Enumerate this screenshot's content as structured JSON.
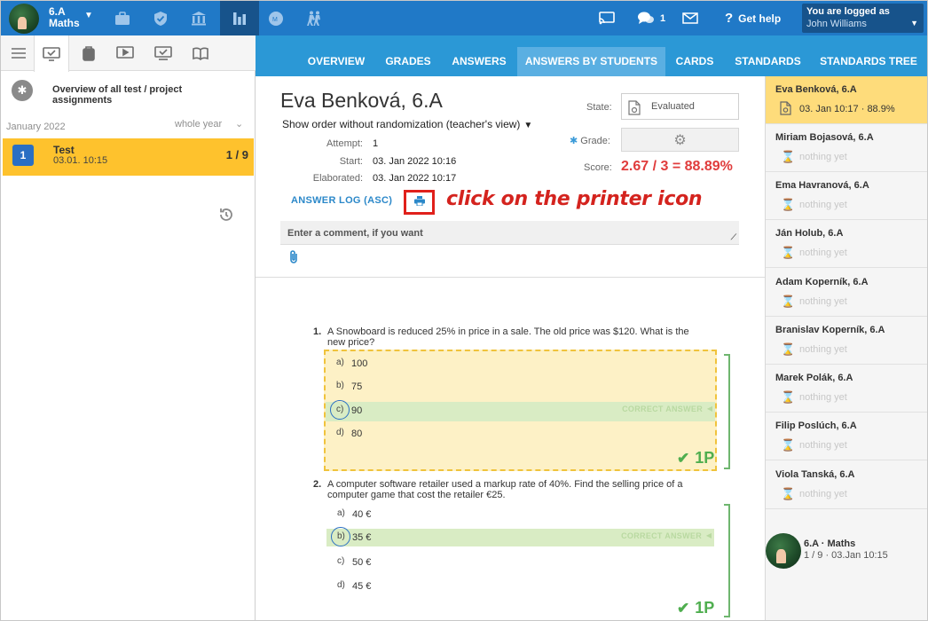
{
  "topbar": {
    "class_name": "6.A",
    "class_subject": "Maths",
    "notifications_count": "1",
    "help_label": "Get help",
    "logged_as_label": "You are logged as",
    "user_name": "John Williams",
    "icons": [
      "briefcase-icon",
      "shield-check-icon",
      "institution-icon",
      "bar-chart-icon",
      "badge-icon",
      "people-walking-icon",
      "cast-icon",
      "chat-icon",
      "mail-icon",
      "question-icon"
    ]
  },
  "left": {
    "tabs": [
      "menu-icon",
      "checklist-icon",
      "backpack-icon",
      "play-icon",
      "check-screen-icon",
      "book-icon"
    ],
    "overview_label": "Overview of all test / project assignments",
    "period_month": "January 2022",
    "period_range": "whole year",
    "test": {
      "number": "1",
      "title": "Test",
      "date": "03.01. 10:15",
      "score": "1 / 9"
    }
  },
  "nav": {
    "tabs": [
      "Overview",
      "Grades",
      "Answers",
      "Answers by students",
      "Cards",
      "Standards",
      "Standards tree"
    ],
    "active": "Answers by students"
  },
  "detail": {
    "student_name": "Eva Benková, 6.A",
    "order_label": "Show order without randomization (teacher's view)",
    "attempt_label": "Attempt:",
    "attempt_value": "1",
    "start_label": "Start:",
    "start_value": "03. Jan 2022 10:16",
    "elaborated_label": "Elaborated:",
    "elaborated_value": "03. Jan 2022 10:17",
    "answer_log_label": "ANSWER LOG (ASC)",
    "annotation": "click on the printer icon",
    "state_label": "State:",
    "state_value": "Evaluated",
    "grade_label": "Grade:",
    "score_label": "Score:",
    "score_value": "2.67 / 3 = 88.89%",
    "comment_placeholder": "Enter a comment, if you want"
  },
  "questions": [
    {
      "number": "1.",
      "text": "A Snowboard is reduced 25% in price in a sale. The old price was $120. What is the new price?",
      "options": [
        {
          "letter": "a)",
          "text": "100",
          "selected": false,
          "correct": false
        },
        {
          "letter": "b)",
          "text": "75",
          "selected": false,
          "correct": false
        },
        {
          "letter": "c)",
          "text": "90",
          "selected": true,
          "correct": true
        },
        {
          "letter": "d)",
          "text": "80",
          "selected": false,
          "correct": false
        }
      ],
      "correct_label": "CORRECT ANSWER",
      "points": "1P"
    },
    {
      "number": "2.",
      "text": "A computer software retailer used a markup rate of 40%. Find the selling price of a computer game that cost the retailer €25.",
      "options": [
        {
          "letter": "a)",
          "text": "40 €",
          "selected": false,
          "correct": false
        },
        {
          "letter": "b)",
          "text": "35 €",
          "selected": true,
          "correct": true
        },
        {
          "letter": "c)",
          "text": "50 €",
          "selected": false,
          "correct": false
        },
        {
          "letter": "d)",
          "text": "45 €",
          "selected": false,
          "correct": false
        }
      ],
      "correct_label": "CORRECT ANSWER",
      "points": "1P"
    }
  ],
  "students": [
    {
      "name": "Eva Benková, 6.A",
      "status": "03. Jan 10:17 · 88.9%",
      "active": true
    },
    {
      "name": "Miriam Bojasová, 6.A",
      "status": "nothing yet",
      "active": false
    },
    {
      "name": "Ema Havranová, 6.A",
      "status": "nothing yet",
      "active": false
    },
    {
      "name": "Ján Holub, 6.A",
      "status": "nothing yet",
      "active": false
    },
    {
      "name": "Adam Koperník, 6.A",
      "status": "nothing yet",
      "active": false
    },
    {
      "name": "Branislav Koperník, 6.A",
      "status": "nothing yet",
      "active": false
    },
    {
      "name": "Marek Polák, 6.A",
      "status": "nothing yet",
      "active": false
    },
    {
      "name": "Filip Poslúch, 6.A",
      "status": "nothing yet",
      "active": false
    },
    {
      "name": "Viola Tanská, 6.A",
      "status": "nothing yet",
      "active": false
    }
  ],
  "class_footer": {
    "title": "6.A · Maths",
    "subtitle": "1 / 9 · 03.Jan 10:15"
  },
  "colors": {
    "topbar": "#2079c7",
    "navbar": "#2b98d6",
    "highlight": "#fec22d",
    "score": "#e03c3c",
    "correct": "#4fae4f",
    "annotation": "#d4231e"
  }
}
